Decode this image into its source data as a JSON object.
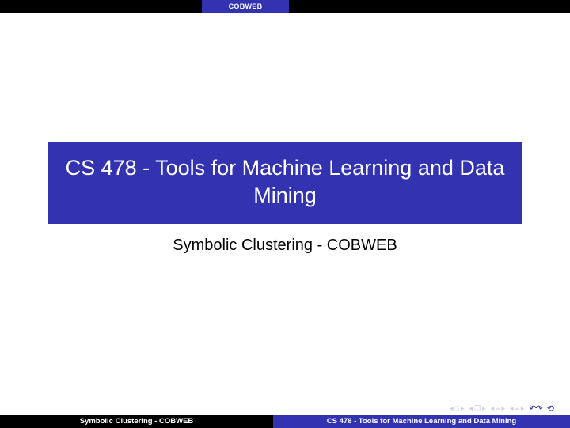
{
  "topbar": {
    "tab_label": "COBWEB"
  },
  "main": {
    "title": "CS 478 - Tools for Machine Learning and Data Mining",
    "subtitle": "Symbolic Clustering - COBWEB"
  },
  "navicons": {
    "frame_prev": "◂",
    "frame_box": "□",
    "frame_next": "▸",
    "subsec_prev": "◂",
    "subsec_box": "❐",
    "subsec_next": "▸",
    "slide_prev": "◂",
    "slide_bar": "≡",
    "slide_next": "▸",
    "slide2_prev": "◂",
    "slide2_bar": "≡",
    "slide2_next": "▸",
    "back_forward": "↶↷",
    "loop": "⟲"
  },
  "footer": {
    "left": "Symbolic Clustering - COBWEB",
    "right": "CS 478 - Tools for Machine Learning and Data Mining"
  }
}
